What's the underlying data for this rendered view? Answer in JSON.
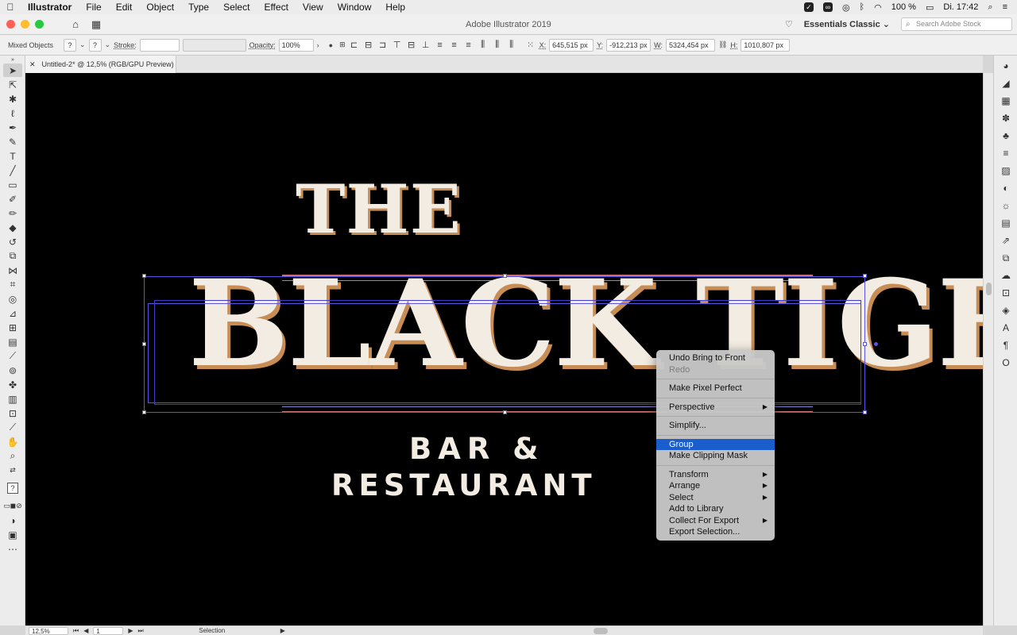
{
  "menubar": {
    "apple": "",
    "app_name": "Illustrator",
    "items": [
      "File",
      "Edit",
      "Object",
      "Type",
      "Select",
      "Effect",
      "View",
      "Window",
      "Help"
    ],
    "battery": "100 %",
    "clock": "Di. 17:42"
  },
  "titlebar": {
    "app_title": "Adobe Illustrator 2019",
    "workspace": "Essentials Classic",
    "search_placeholder": "Search Adobe Stock"
  },
  "control_bar": {
    "selection_type": "Mixed Objects",
    "stroke_label": "Stroke:",
    "opacity_label": "Opacity:",
    "opacity_value": "100%",
    "x_label": "X:",
    "x_value": "645,515 px",
    "y_label": "Y:",
    "y_value": "-912,213 px",
    "w_label": "W:",
    "w_value": "5324,454 px",
    "h_label": "H:",
    "h_value": "1010,807 px"
  },
  "document_tab": {
    "title": "Untitled-2* @ 12,5% (RGB/GPU Preview)"
  },
  "artwork": {
    "the": "THE",
    "main": "BLACK TIGER",
    "bar": "BAR &",
    "restaurant": "RESTAURANT"
  },
  "context_menu": {
    "items": [
      {
        "label": "Undo Bring to Front",
        "disabled": false,
        "submenu": false
      },
      {
        "label": "Redo",
        "disabled": true,
        "submenu": false
      },
      {
        "separator": true
      },
      {
        "label": "Make Pixel Perfect",
        "disabled": false,
        "submenu": false
      },
      {
        "separator": true
      },
      {
        "label": "Perspective",
        "disabled": false,
        "submenu": true
      },
      {
        "separator": true
      },
      {
        "label": "Simplify...",
        "disabled": false,
        "submenu": false
      },
      {
        "separator": true
      },
      {
        "label": "Group",
        "disabled": false,
        "submenu": false,
        "highlighted": true
      },
      {
        "label": "Make Clipping Mask",
        "disabled": false,
        "submenu": false
      },
      {
        "separator": true
      },
      {
        "label": "Transform",
        "disabled": false,
        "submenu": true
      },
      {
        "label": "Arrange",
        "disabled": false,
        "submenu": true
      },
      {
        "label": "Select",
        "disabled": false,
        "submenu": true
      },
      {
        "label": "Add to Library",
        "disabled": false,
        "submenu": false
      },
      {
        "label": "Collect For Export",
        "disabled": false,
        "submenu": true
      },
      {
        "label": "Export Selection...",
        "disabled": false,
        "submenu": false
      }
    ]
  },
  "status_bar": {
    "zoom": "12,5%",
    "artboard": "1",
    "tool": "Selection"
  },
  "colors": {
    "canvas_bg": "#000000",
    "artwork_fill": "#f2ece2",
    "artwork_shadow": "#c88c55",
    "selection": "#5a55e6",
    "menu_highlight": "#1a5dcc"
  }
}
